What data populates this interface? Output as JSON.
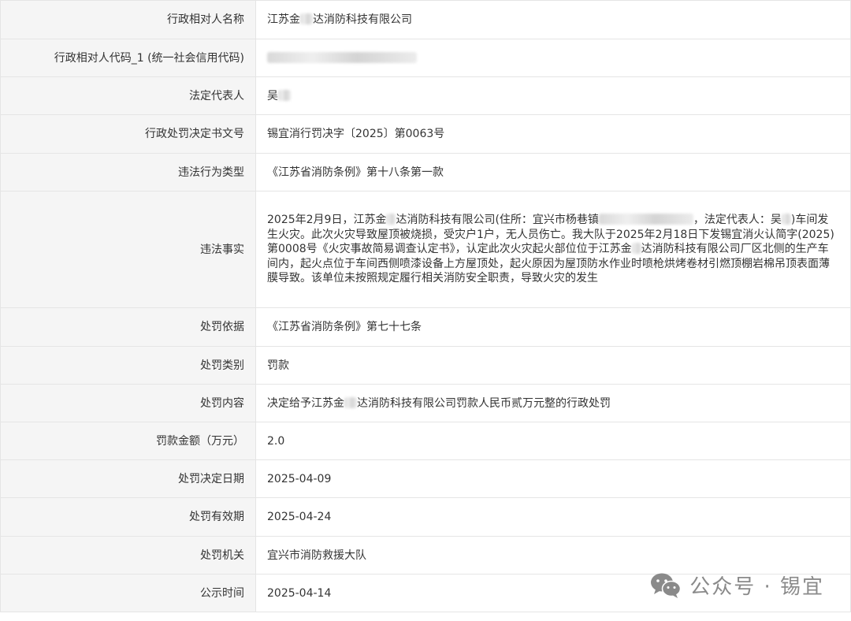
{
  "rows": [
    {
      "label": "行政相对人名称",
      "value_pre": "江苏金",
      "value_post": "达消防科技有限公司"
    },
    {
      "label": "行政相对人代码_1 (统一社会信用代码)",
      "value": ""
    },
    {
      "label": "法定代表人",
      "value": "吴"
    },
    {
      "label": "行政处罚决定书文号",
      "value": "锡宜消行罚决字〔2025〕第0063号"
    },
    {
      "label": "违法行为类型",
      "value": "《江苏省消防条例》第十八条第一款"
    },
    {
      "label": "违法事实",
      "p1": "2025年2月9日，江苏金",
      "p2": "达消防科技有限公司(住所：宜兴市杨巷镇",
      "p3": "，法定代表人：吴",
      "p4": ")车间发生火灾。此次火灾导致屋顶被烧损，受灾户1户，无人员伤亡。我大队于2025年2月18日下发锡宜消火认简字(2025)第0008号《火灾事故简易调查认定书》，认定此次火灾起火部位位于江苏金",
      "p5": "达消防科技有限公司厂区北侧的生产车间内，起火点位于车间西侧喷漆设备上方屋顶处，起火原因为屋顶防水作业时喷枪烘烤卷材引燃顶棚岩棉吊顶表面薄膜导致。该单位未按照规定履行相关消防安全职责，导致火灾的发生"
    },
    {
      "label": "处罚依据",
      "value": "《江苏省消防条例》第七十七条"
    },
    {
      "label": "处罚类别",
      "value": "罚款"
    },
    {
      "label": "处罚内容",
      "value_pre": "决定给予江苏金",
      "value_post": "达消防科技有限公司罚款人民币贰万元整的行政处罚"
    },
    {
      "label": "罚款金额（万元）",
      "value": "2.0"
    },
    {
      "label": "处罚决定日期",
      "value": "2025-04-09"
    },
    {
      "label": "处罚有效期",
      "value": "2025-04-24"
    },
    {
      "label": "处罚机关",
      "value": "宜兴市消防救援大队"
    },
    {
      "label": "公示时间",
      "value": "2025-04-14"
    }
  ],
  "watermark": {
    "text": "公众号 · 锡宜",
    "icon": "wechat-icon"
  }
}
